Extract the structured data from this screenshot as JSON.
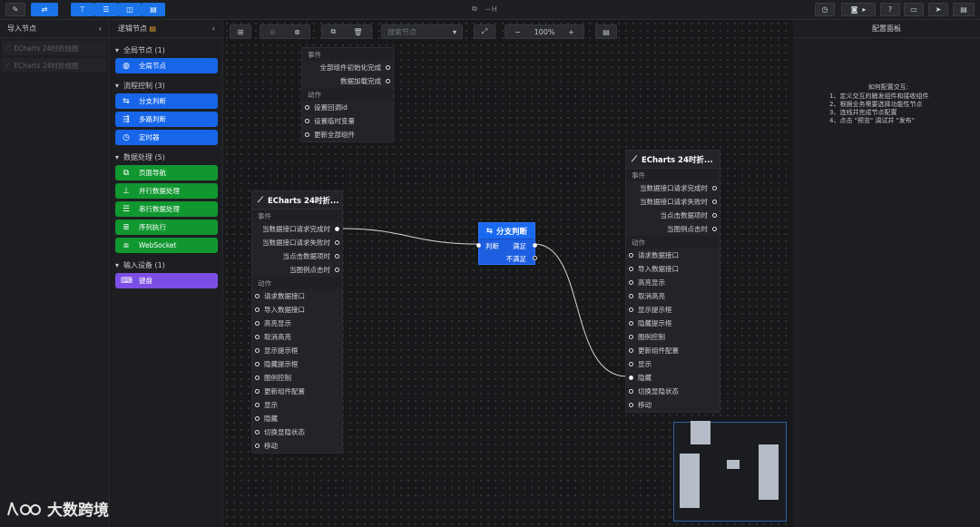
{
  "window": {
    "title": "－H"
  },
  "toolbar": {
    "right_icons": [
      "clock-icon",
      "camera-icon",
      "play-icon",
      "help-icon",
      "monitor-icon",
      "send-icon",
      "message-icon"
    ]
  },
  "import_panel": {
    "title": "导入节点",
    "items": [
      "ECharts 24时折线图",
      "ECharts 24时折线图"
    ]
  },
  "logic_panel": {
    "title": "逻辑节点",
    "categories": [
      {
        "label": "全局节点 (1)",
        "nodes": [
          {
            "label": "全局节点",
            "color": "blue",
            "icon": "globe-icon"
          }
        ]
      },
      {
        "label": "流程控制 (3)",
        "nodes": [
          {
            "label": "分支判断",
            "color": "blue",
            "icon": "branch-icon"
          },
          {
            "label": "多路判断",
            "color": "blue",
            "icon": "multiway-icon"
          },
          {
            "label": "定时器",
            "color": "blue",
            "icon": "clock-icon"
          }
        ]
      },
      {
        "label": "数据处理 (5)",
        "nodes": [
          {
            "label": "页面导航",
            "color": "green",
            "icon": "external-link-icon"
          },
          {
            "label": "并行数据处理",
            "color": "green",
            "icon": "parallel-icon"
          },
          {
            "label": "串行数据处理",
            "color": "green",
            "icon": "serial-icon"
          },
          {
            "label": "序列执行",
            "color": "green",
            "icon": "sequence-icon"
          },
          {
            "label": "WebSocket",
            "color": "green",
            "icon": "websocket-icon"
          }
        ]
      },
      {
        "label": "输入设备 (1)",
        "nodes": [
          {
            "label": "键盘",
            "color": "purple",
            "icon": "keyboard-icon"
          }
        ]
      }
    ]
  },
  "canvas_toolbar": {
    "search_placeholder": "搜索节点",
    "zoom": "100%",
    "zoom_out": "−",
    "zoom_in": "+"
  },
  "global_node": {
    "events_label": "事件",
    "events": [
      "全部组件初始化完成",
      "数据加载完成"
    ],
    "actions_label": "动作",
    "actions": [
      "设置回调id",
      "设置临时变量",
      "更新全部组件"
    ]
  },
  "echarts_left": {
    "title": "ECharts 24时折...",
    "events_label": "事件",
    "events": [
      "当数据接口请求完成时",
      "当数据接口请求失败时",
      "当点击数据项时",
      "当图例点击时"
    ],
    "actions_label": "动作",
    "actions": [
      "请求数据接口",
      "导入数据接口",
      "高亮显示",
      "取消高亮",
      "显示提示框",
      "隐藏提示框",
      "图例控制",
      "更新组件配置",
      "显示",
      "隐藏",
      "切换显隐状态",
      "移动"
    ]
  },
  "branch_node": {
    "title": "分支判断",
    "input": "判断",
    "out_yes": "满足",
    "out_no": "不满足"
  },
  "echarts_right": {
    "title": "ECharts 24时折...",
    "events_label": "事件",
    "events": [
      "当数据接口请求完成时",
      "当数据接口请求失败时",
      "当点击数据项时",
      "当图例点击时"
    ],
    "actions_label": "动作",
    "actions": [
      "请求数据接口",
      "导入数据接口",
      "高亮显示",
      "取消高亮",
      "显示提示框",
      "隐藏提示框",
      "图例控制",
      "更新组件配置",
      "显示",
      "隐藏",
      "切换显隐状态",
      "移动"
    ]
  },
  "config_panel": {
    "title": "配置面板",
    "help_title": "如何配置交互:",
    "help_lines": [
      "1、定义交互的触发组件和接收组件",
      "2、根据业务需要选择功能性节点",
      "3、连线并完成节点配置",
      "4、点击 \"预览\" 调试并 \"发布\""
    ]
  },
  "brand": {
    "text": "大数跨境"
  }
}
